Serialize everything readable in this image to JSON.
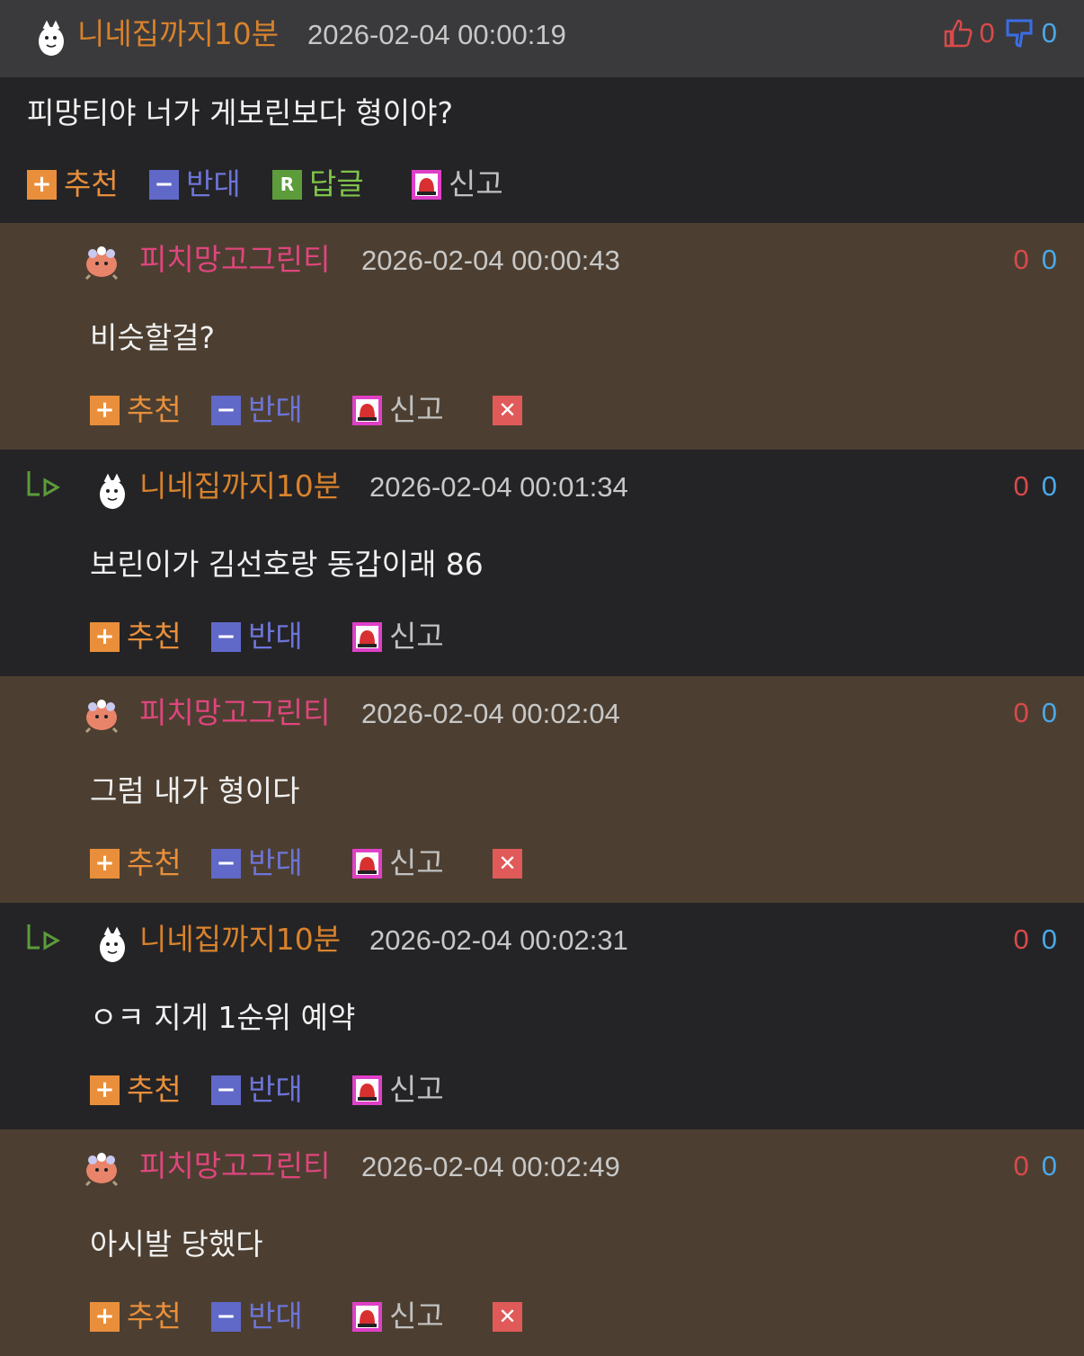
{
  "colors": {
    "header_bg": "#3a3a3c",
    "dark_bg": "#242426",
    "brown_bg": "#4c3f31",
    "nick_orange": "#d8822c",
    "nick_pink": "#e0457e",
    "upvote": "#d94a4a",
    "downvote": "#4aa8e8"
  },
  "icons": [
    "thumbs-up-icon",
    "thumbs-down-icon",
    "plus-icon",
    "minus-icon",
    "reply-r-icon",
    "siren-report-icon",
    "delete-x-icon",
    "reply-arrow-icon",
    "avatar-icon"
  ],
  "main_comment": {
    "nick": "니네집까지10분",
    "time": "2026-02-04 00:00:19",
    "up": "0",
    "down": "0",
    "content": "피망티야 너가 게보린보다 형이야?",
    "recommend": "추천",
    "oppose": "반대",
    "reply": "답글",
    "report": "신고"
  },
  "replies": [
    {
      "nick": "피치망고그린티",
      "time": "2026-02-04 00:00:43",
      "up": "0",
      "down": "0",
      "content": "비슷할걸?",
      "recommend": "추천",
      "oppose": "반대",
      "report": "신고"
    },
    {
      "nick": "니네집까지10분",
      "time": "2026-02-04 00:01:34",
      "up": "0",
      "down": "0",
      "content": "보린이가 김선호랑 동갑이래 86",
      "recommend": "추천",
      "oppose": "반대",
      "report": "신고"
    },
    {
      "nick": "피치망고그린티",
      "time": "2026-02-04 00:02:04",
      "up": "0",
      "down": "0",
      "content": "그럼 내가 형이다",
      "recommend": "추천",
      "oppose": "반대",
      "report": "신고"
    },
    {
      "nick": "니네집까지10분",
      "time": "2026-02-04 00:02:31",
      "up": "0",
      "down": "0",
      "content": "ㅇㅋ 지게 1순위 예약",
      "recommend": "추천",
      "oppose": "반대",
      "report": "신고"
    },
    {
      "nick": "피치망고그린티",
      "time": "2026-02-04 00:02:49",
      "up": "0",
      "down": "0",
      "content": "아시발 당했다",
      "recommend": "추천",
      "oppose": "반대",
      "report": "신고"
    }
  ]
}
